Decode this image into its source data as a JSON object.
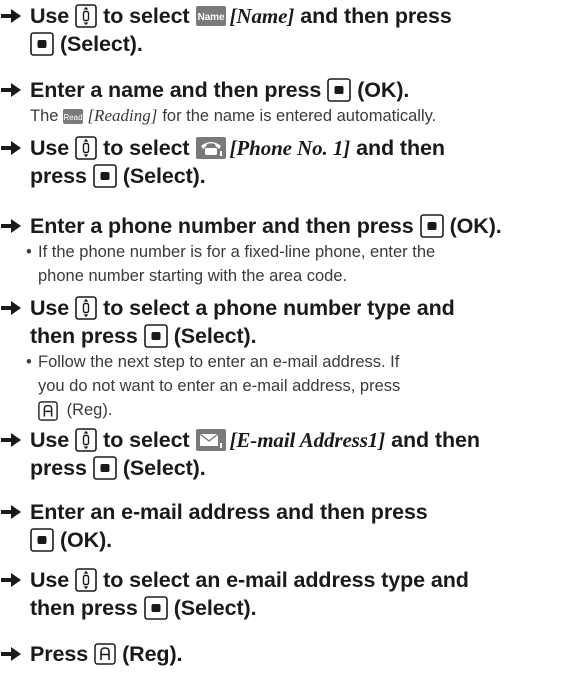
{
  "icons": {
    "arrow": "right-arrow-icon",
    "nav_key": "up-down-nav-key-icon",
    "center_key": "center-select-key-icon",
    "a_key": "a-key-icon",
    "name_chip": "name-chip-icon",
    "read_chip": "read-chip-icon",
    "phone_chip": "phone-chip-icon",
    "mail_chip": "mail-chip-icon"
  },
  "colors": {
    "text": "#1a1a1a",
    "subtext": "#3a3a3a",
    "chip": "#7a7a7a"
  },
  "labels": {
    "name_chip": "Name",
    "read_chip": "Read",
    "a_key": "A"
  },
  "steps": [
    {
      "l1_use": "Use",
      "l1_to": "to select",
      "l1_item": "[Name]",
      "l1_rest": "and then press",
      "l2": "(Select)."
    },
    {
      "l1": "Enter a name and then press",
      "l1_end": "(OK).",
      "sub_pre": "The",
      "sub_item": "[Reading]",
      "sub_rest": "for the name is entered automatically."
    },
    {
      "l1_use": "Use",
      "l1_to": "to select",
      "l1_item": "[Phone No. 1]",
      "l1_rest": "and then",
      "l2_pre": "press",
      "l2_end": "(Select)."
    },
    {
      "l1": "Enter a phone number and then press",
      "l1_end": "(OK).",
      "bullet": "•",
      "sub_1": "If the phone number is for a fixed-line phone, enter the",
      "sub_2": "phone number starting with the area code."
    },
    {
      "l1_use": "Use",
      "l1_rest": "to select a phone number type and",
      "l2_pre": "then press",
      "l2_end": "(Select).",
      "bullet": "•",
      "sub_1": "Follow the next step to enter an e-mail address. If",
      "sub_2": "you do not want to enter an e-mail address, press",
      "sub_3": "(Reg)."
    },
    {
      "l1_use": "Use",
      "l1_to": "to select",
      "l1_item": "[E-mail Address1]",
      "l1_rest": "and then",
      "l2_pre": "press",
      "l2_end": "(Select)."
    },
    {
      "l1": "Enter an e-mail address and then press",
      "l2": "(OK)."
    },
    {
      "l1_use": "Use",
      "l1_rest": "to select an e-mail address type and",
      "l2_pre": "then press",
      "l2_end": "(Select)."
    },
    {
      "l1_pre": "Press",
      "l1_end": "(Reg)."
    }
  ]
}
